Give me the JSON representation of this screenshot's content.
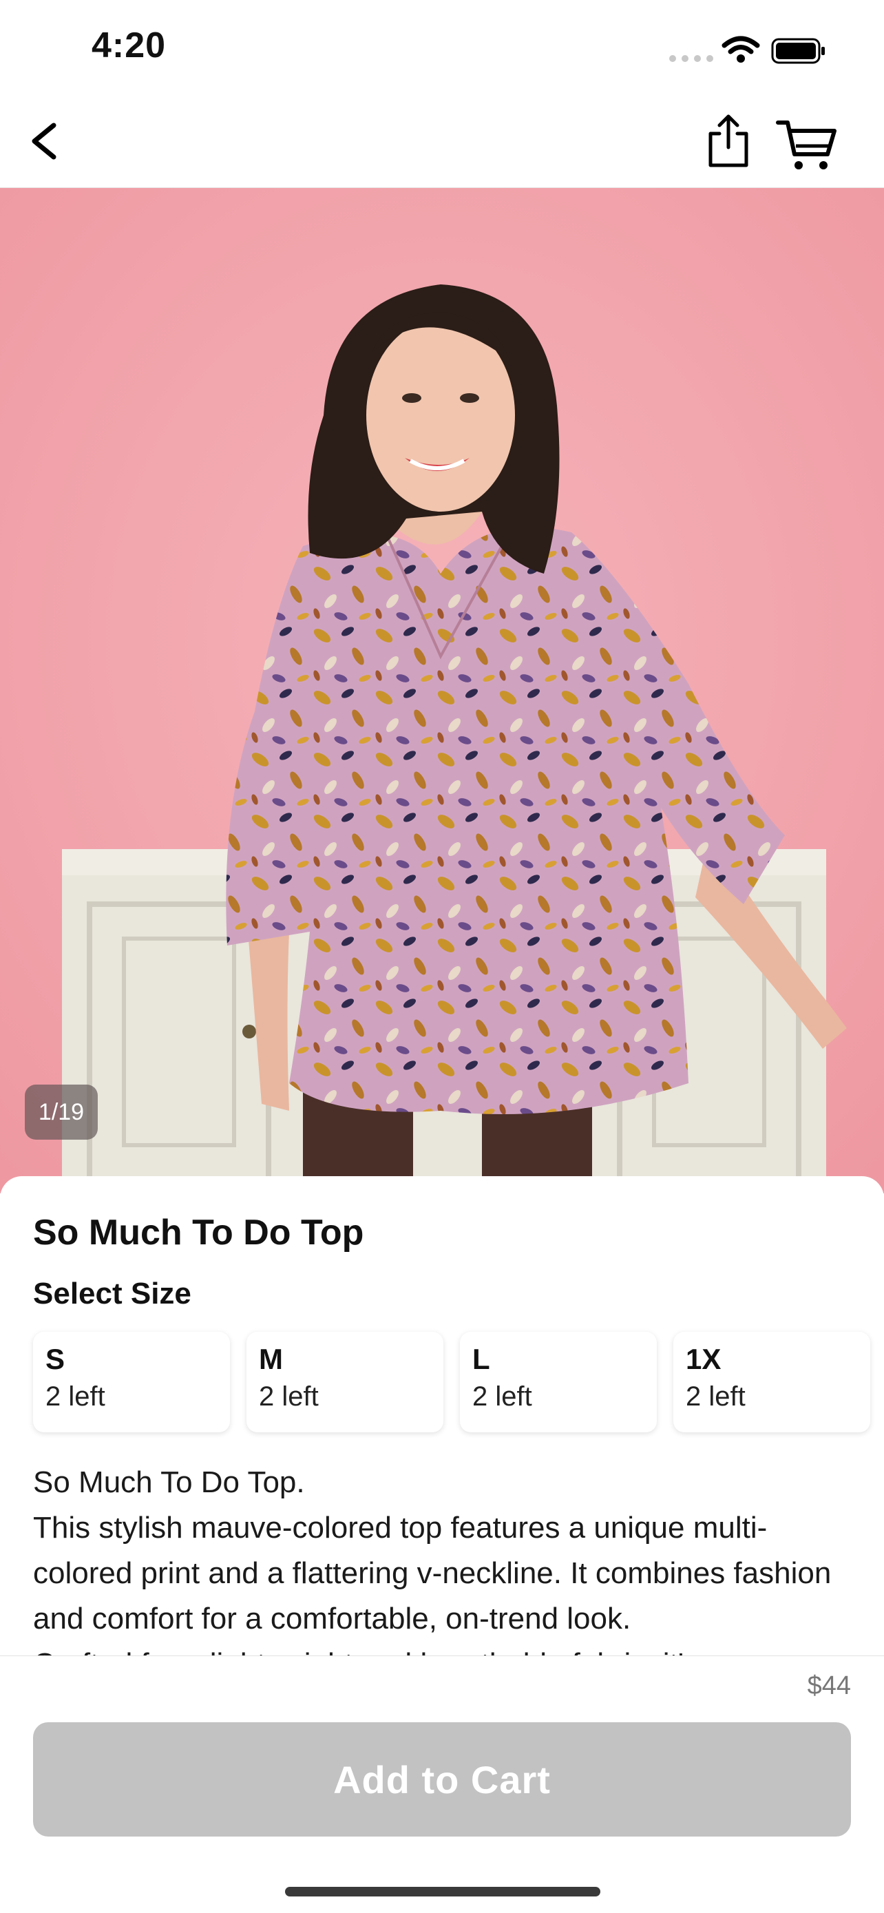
{
  "status_bar": {
    "time": "4:20"
  },
  "nav": {
    "back_icon": "chevron-left-icon",
    "share_icon": "share-icon",
    "cart_icon": "cart-icon"
  },
  "gallery": {
    "counter": "1/19",
    "background_color": "#f2a1a8"
  },
  "product": {
    "title": "So Much To Do Top",
    "size_heading": "Select Size",
    "sizes": [
      {
        "name": "S",
        "stock": "2 left"
      },
      {
        "name": "M",
        "stock": "2 left"
      },
      {
        "name": "L",
        "stock": "2 left"
      },
      {
        "name": "1X",
        "stock": "2 left"
      }
    ],
    "description_line1": "So Much To Do Top.",
    "description_line2": "This stylish mauve-colored top features a unique multi-colored print and a flattering v-neckline. It combines fashion and comfort for a comfortable, on-trend look.",
    "description_line3": "Crafted from lightweight and breathable fabric, it's"
  },
  "footer": {
    "price": "$44",
    "add_to_cart_label": "Add to Cart",
    "button_color": "#c2c2c2"
  }
}
